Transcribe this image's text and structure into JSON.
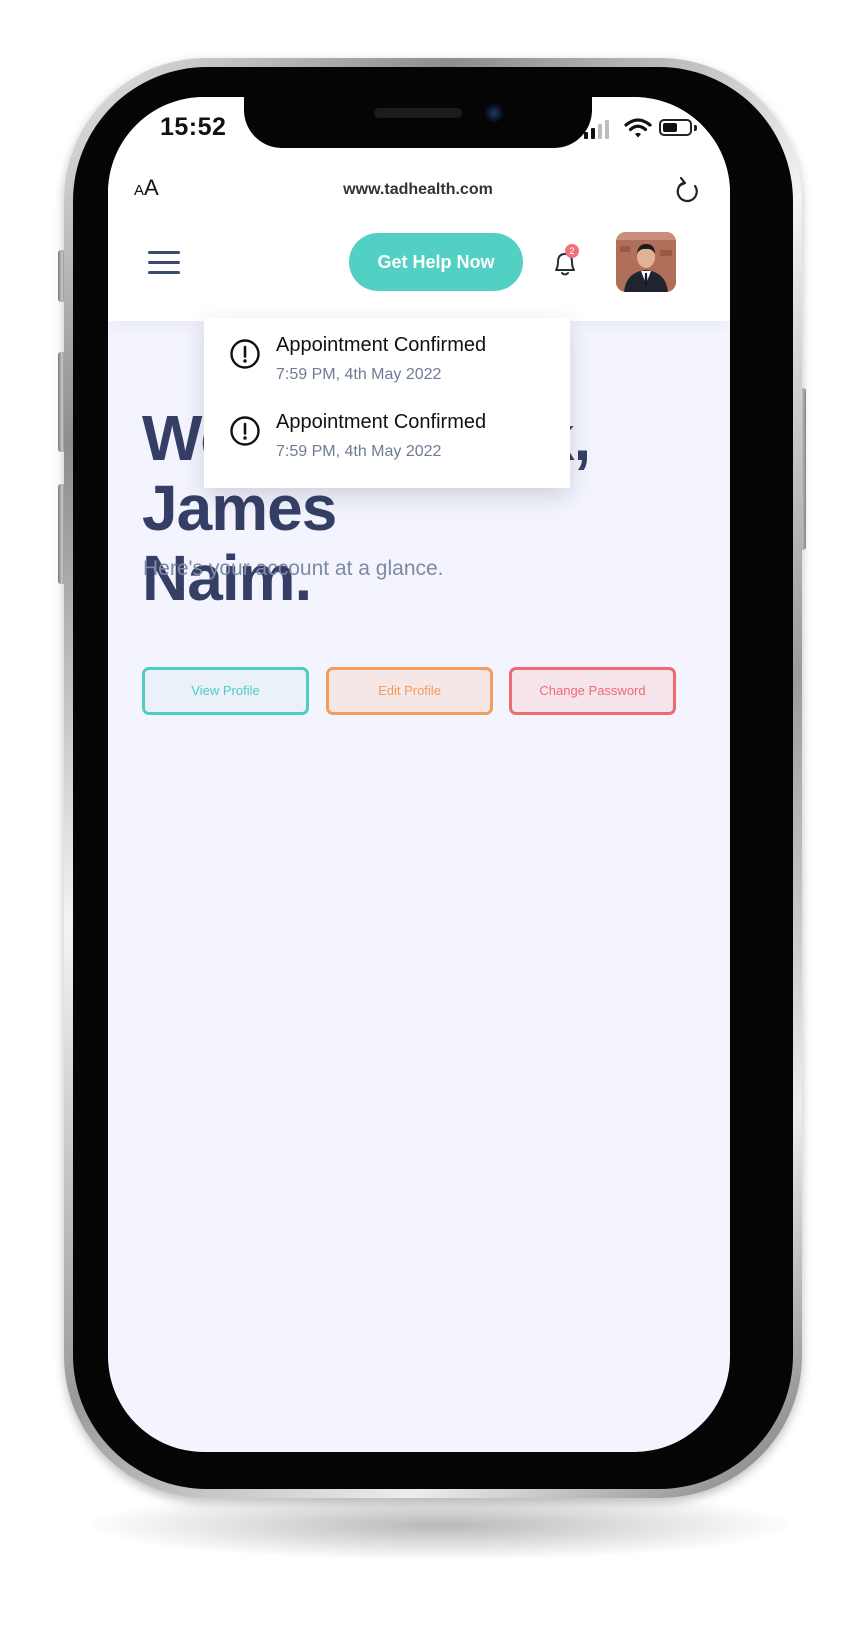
{
  "status_bar": {
    "time": "15:52"
  },
  "browser": {
    "aa_small": "A",
    "aa_big": "A",
    "url": "www.tadhealth.com"
  },
  "header": {
    "help_button_label": "Get Help Now",
    "notification_count": "2"
  },
  "notifications": [
    {
      "title": "Appointment Confirmed",
      "time": "7:59 PM, 4th May 2022"
    },
    {
      "title": "Appointment Confirmed",
      "time": "7:59 PM, 4th May 2022"
    }
  ],
  "main": {
    "welcome_line1": "Welcome back, James",
    "welcome_line2": "Naim.",
    "subtitle": "Here's your account at a glance.",
    "buttons": {
      "view_profile": "View Profile",
      "edit_profile": "Edit Profile",
      "change_password": "Change Password"
    }
  },
  "colors": {
    "accent_teal": "#53d0c4",
    "accent_orange": "#f49c5f",
    "accent_red": "#ef6b72",
    "heading": "#353f66",
    "background": "#f3f4fd"
  },
  "icons": [
    "text-size-icon",
    "reload-icon",
    "hamburger-menu-icon",
    "bell-icon",
    "alert-circle-icon",
    "signal-icon",
    "wifi-icon",
    "battery-icon"
  ]
}
